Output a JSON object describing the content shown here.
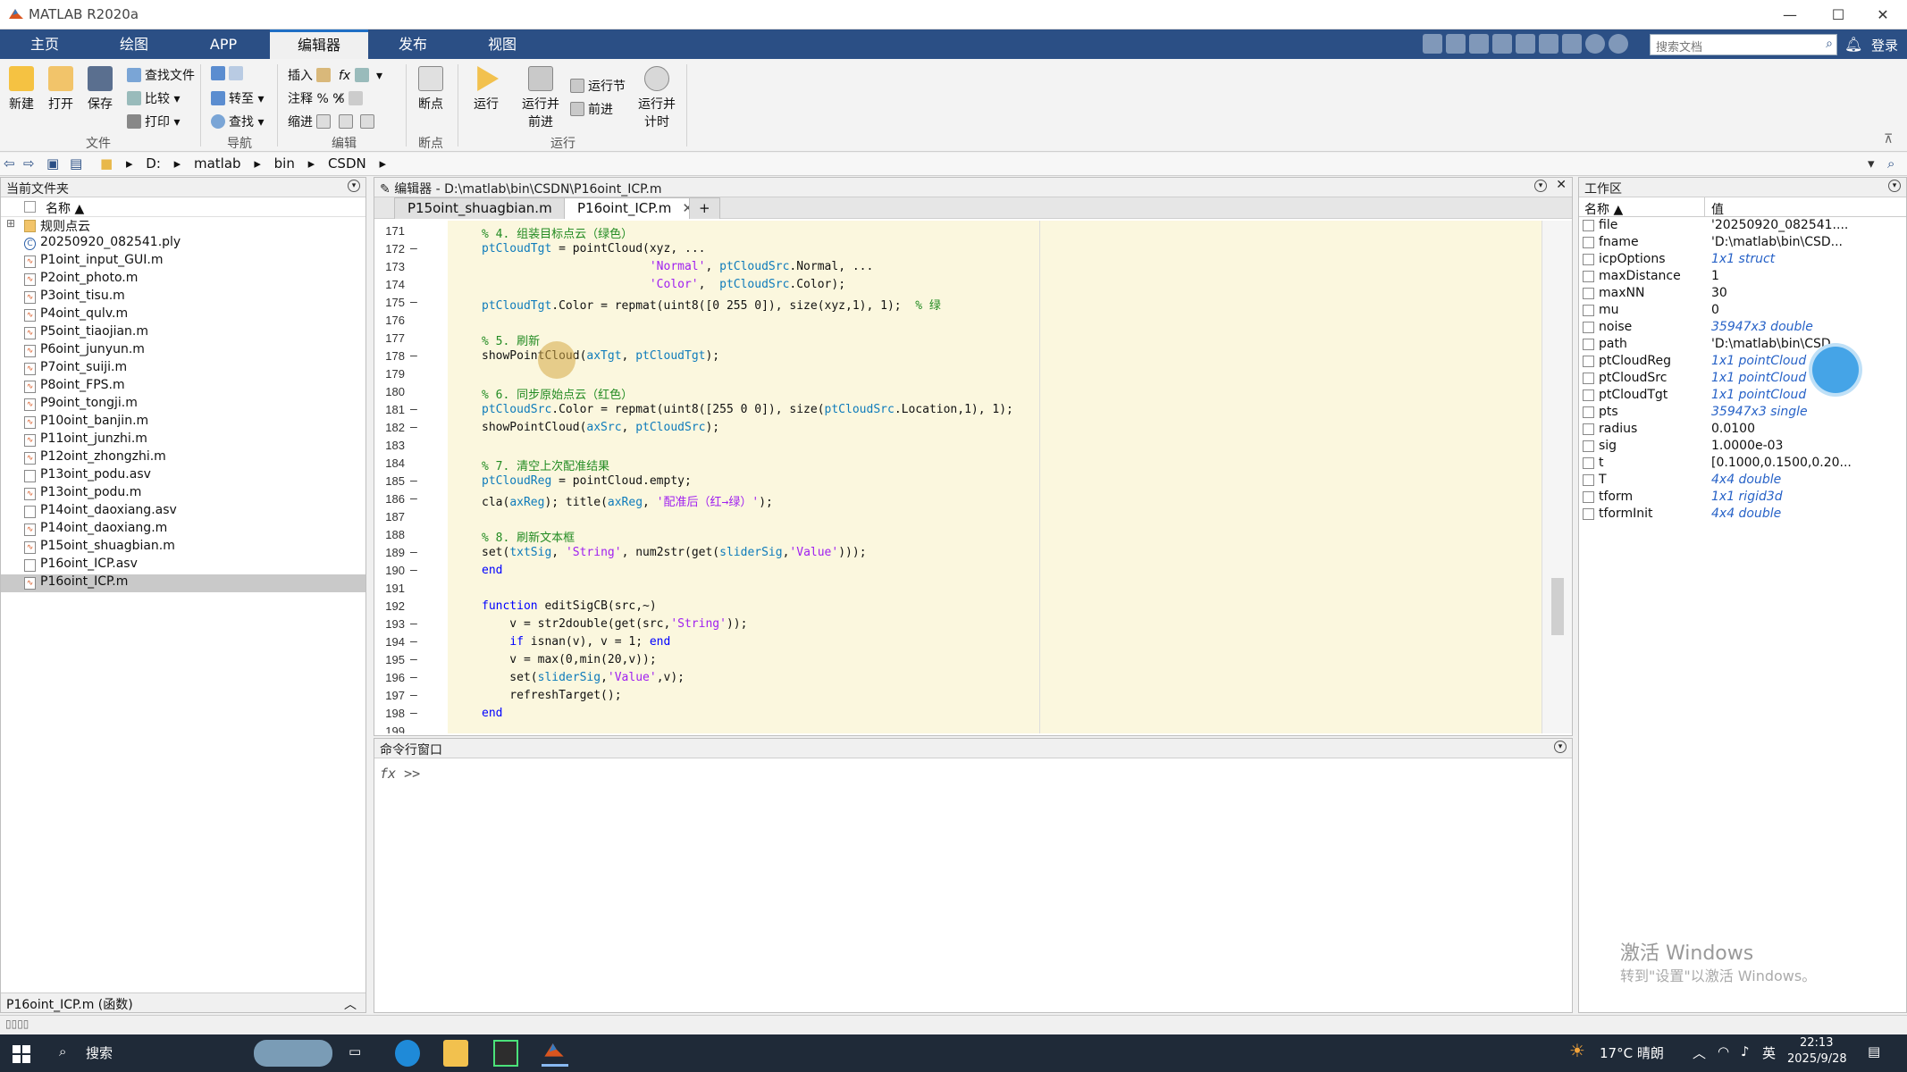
{
  "window": {
    "title": "MATLAB R2020a",
    "minimize": "—",
    "maximize": "☐",
    "close": "✕"
  },
  "ribbon_tabs": [
    "主页",
    "绘图",
    "APP",
    "编辑器",
    "发布",
    "视图"
  ],
  "search": {
    "placeholder": "搜索文档"
  },
  "login": "登录",
  "ribbon": {
    "new": "新建",
    "open": "打开",
    "save": "保存",
    "find_files": "查找文件",
    "compare": "比较",
    "print": "打印",
    "goto": "转至",
    "find": "查找",
    "insert": "插入",
    "comment": "注释",
    "indent": "缩进",
    "breakpoints": "断点",
    "run": "运行",
    "run_advance": "运行并\n前进",
    "run_section": "运行节",
    "advance": "前进",
    "run_time": "运行并\n计时",
    "groups": {
      "file": "文件",
      "navigate": "导航",
      "edit": "编辑",
      "breakpoints": "断点",
      "run": "运行"
    }
  },
  "address": {
    "segments": [
      "D:",
      "matlab",
      "bin",
      "CSDN"
    ]
  },
  "current_folder": {
    "title": "当前文件夹",
    "col_name": "名称 ▲",
    "items": [
      {
        "name": "规则点云",
        "type": "folder"
      },
      {
        "name": "20250920_082541.ply",
        "type": "ply"
      },
      {
        "name": "P1oint_input_GUI.m",
        "type": "m"
      },
      {
        "name": "P2oint_photo.m",
        "type": "m"
      },
      {
        "name": "P3oint_tisu.m",
        "type": "m"
      },
      {
        "name": "P4oint_qulv.m",
        "type": "m"
      },
      {
        "name": "P5oint_tiaojian.m",
        "type": "m"
      },
      {
        "name": "P6oint_junyun.m",
        "type": "m"
      },
      {
        "name": "P7oint_suiji.m",
        "type": "m"
      },
      {
        "name": "P8oint_FPS.m",
        "type": "m"
      },
      {
        "name": "P9oint_tongji.m",
        "type": "m"
      },
      {
        "name": "P10oint_banjin.m",
        "type": "m"
      },
      {
        "name": "P11oint_junzhi.m",
        "type": "m"
      },
      {
        "name": "P12oint_zhongzhi.m",
        "type": "m"
      },
      {
        "name": "P13oint_podu.asv",
        "type": "asv"
      },
      {
        "name": "P13oint_podu.m",
        "type": "m"
      },
      {
        "name": "P14oint_daoxiang.asv",
        "type": "asv"
      },
      {
        "name": "P14oint_daoxiang.m",
        "type": "m"
      },
      {
        "name": "P15oint_shuagbian.m",
        "type": "m"
      },
      {
        "name": "P16oint_ICP.asv",
        "type": "asv"
      },
      {
        "name": "P16oint_ICP.m",
        "type": "m",
        "selected": true
      }
    ],
    "detail": "P16oint_ICP.m (函数)"
  },
  "editor": {
    "title": "编辑器 - D:\\matlab\\bin\\CSDN\\P16oint_ICP.m",
    "tabs": [
      "P15oint_shuagbian.m",
      "P16oint_ICP.m"
    ],
    "active_tab": 1,
    "lines": [
      {
        "n": "171",
        "dash": false,
        "html": "<span class=\"cm\">% 4. 组装目标点云（绿色）</span>"
      },
      {
        "n": "172",
        "dash": true,
        "html": "<span class=\"var\">ptCloudTgt</span> = pointCloud(xyz, ..."
      },
      {
        "n": "173",
        "dash": false,
        "html": "                        <span class=\"str\">'Normal'</span>, <span class=\"var\">ptCloudSrc</span>.Normal, ..."
      },
      {
        "n": "174",
        "dash": false,
        "html": "                        <span class=\"str\">'Color'</span>,  <span class=\"var\">ptCloudSrc</span>.Color);"
      },
      {
        "n": "175",
        "dash": true,
        "html": "<span class=\"var\">ptCloudTgt</span>.Color = repmat(uint8([0 255 0]), size(xyz,1), 1);  <span class=\"cm\">% 绿</span>"
      },
      {
        "n": "176",
        "dash": false,
        "html": ""
      },
      {
        "n": "177",
        "dash": false,
        "html": "<span class=\"cm\">% 5. 刷新</span>"
      },
      {
        "n": "178",
        "dash": true,
        "html": "showPointCloud(<span class=\"var\">axTgt</span>, <span class=\"var\">ptCloudTgt</span>);"
      },
      {
        "n": "179",
        "dash": false,
        "html": ""
      },
      {
        "n": "180",
        "dash": false,
        "html": "<span class=\"cm\">% 6. 同步原始点云（红色）</span>"
      },
      {
        "n": "181",
        "dash": true,
        "html": "<span class=\"var\">ptCloudSrc</span>.Color = repmat(uint8([255 0 0]), size(<span class=\"var\">ptCloudSrc</span>.Location,1), 1);"
      },
      {
        "n": "182",
        "dash": true,
        "html": "showPointCloud(<span class=\"var\">axSrc</span>, <span class=\"var\">ptCloudSrc</span>);"
      },
      {
        "n": "183",
        "dash": false,
        "html": ""
      },
      {
        "n": "184",
        "dash": false,
        "html": "<span class=\"cm\">% 7. 清空上次配准结果</span>"
      },
      {
        "n": "185",
        "dash": true,
        "html": "<span class=\"var\">ptCloudReg</span> = pointCloud.empty;"
      },
      {
        "n": "186",
        "dash": true,
        "html": "cla(<span class=\"var\">axReg</span>); title(<span class=\"var\">axReg</span>, <span class=\"str\">'配准后（红→绿）'</span>);"
      },
      {
        "n": "187",
        "dash": false,
        "html": ""
      },
      {
        "n": "188",
        "dash": false,
        "html": "<span class=\"cm\">% 8. 刷新文本框</span>"
      },
      {
        "n": "189",
        "dash": true,
        "html": "set(<span class=\"var\">txtSig</span>, <span class=\"str\">'String'</span>, num2str(get(<span class=\"var\">sliderSig</span>,<span class=\"str\">'Value'</span>)));"
      },
      {
        "n": "190",
        "dash": true,
        "html": "<span class=\"kw\">end</span>"
      },
      {
        "n": "191",
        "dash": false,
        "html": ""
      },
      {
        "n": "192",
        "dash": false,
        "html": "<span class=\"kw\">function</span> editSigCB(src,~)"
      },
      {
        "n": "193",
        "dash": true,
        "html": "    v = str2double(get(src,<span class=\"str\">'String'</span>));"
      },
      {
        "n": "194",
        "dash": true,
        "html": "    <span class=\"kw\">if</span> isnan(v), v = 1; <span class=\"kw\">end</span>"
      },
      {
        "n": "195",
        "dash": true,
        "html": "    v = max(0,min(20,v));"
      },
      {
        "n": "196",
        "dash": true,
        "html": "    set(<span class=\"var\">sliderSig</span>,<span class=\"str\">'Value'</span>,v);"
      },
      {
        "n": "197",
        "dash": true,
        "html": "    refreshTarget();"
      },
      {
        "n": "198",
        "dash": true,
        "html": "<span class=\"kw\">end</span>"
      },
      {
        "n": "199",
        "dash": false,
        "html": ""
      }
    ]
  },
  "command_window": {
    "title": "命令行窗口",
    "prompt": ">>",
    "fx": "fx"
  },
  "workspace": {
    "title": "工作区",
    "col_name": "名称 ▲",
    "col_value": "值",
    "vars": [
      {
        "name": "file",
        "value": "'20250920_082541....",
        "italic": false
      },
      {
        "name": "fname",
        "value": "'D:\\matlab\\bin\\CSD...",
        "italic": false
      },
      {
        "name": "icpOptions",
        "value": "1x1 struct",
        "italic": true
      },
      {
        "name": "maxDistance",
        "value": "1",
        "italic": false
      },
      {
        "name": "maxNN",
        "value": "30",
        "italic": false
      },
      {
        "name": "mu",
        "value": "0",
        "italic": false
      },
      {
        "name": "noise",
        "value": "35947x3 double",
        "italic": true
      },
      {
        "name": "path",
        "value": "'D:\\matlab\\bin\\CSD...",
        "italic": false
      },
      {
        "name": "ptCloudReg",
        "value": "1x1 pointCloud",
        "italic": true
      },
      {
        "name": "ptCloudSrc",
        "value": "1x1 pointCloud",
        "italic": true
      },
      {
        "name": "ptCloudTgt",
        "value": "1x1 pointCloud",
        "italic": true
      },
      {
        "name": "pts",
        "value": "35947x3 single",
        "italic": true
      },
      {
        "name": "radius",
        "value": "0.0100",
        "italic": false
      },
      {
        "name": "sig",
        "value": "1.0000e-03",
        "italic": false
      },
      {
        "name": "t",
        "value": "[0.1000,0.1500,0.20...",
        "italic": false
      },
      {
        "name": "T",
        "value": "4x4 double",
        "italic": true
      },
      {
        "name": "tform",
        "value": "1x1 rigid3d",
        "italic": true
      },
      {
        "name": "tformInit",
        "value": "4x4 double",
        "italic": true
      }
    ],
    "activate_title": "激活 Windows",
    "activate_sub": "转到\"设置\"以激活 Windows。"
  },
  "taskbar": {
    "search": "搜索",
    "weather": "17°C 晴朗",
    "ime": "英",
    "time": "22:13",
    "date": "2025/9/28"
  },
  "colors": {
    "ribbon_blue": "#2b4f85",
    "editor_bg": "#fbf7de",
    "keyword": "#0000ff",
    "string": "#a020f0",
    "comment": "#228b22"
  }
}
